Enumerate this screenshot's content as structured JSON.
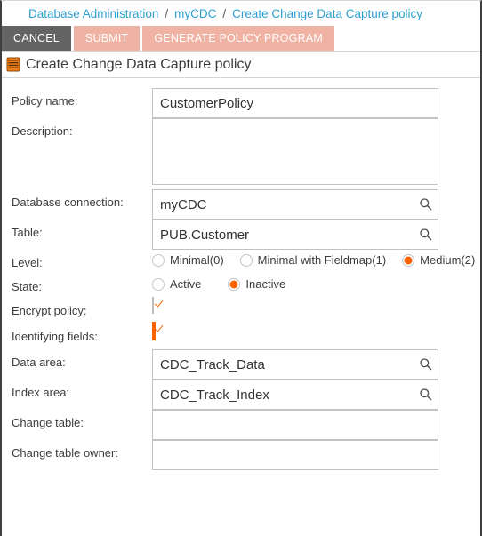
{
  "breadcrumb": {
    "separator": "/",
    "items": [
      {
        "label": "Database Administration"
      },
      {
        "label": "myCDC"
      },
      {
        "label": "Create Change Data Capture policy"
      }
    ]
  },
  "toolbar": {
    "cancel_label": "CANCEL",
    "submit_label": "SUBMIT",
    "generate_label": "GENERATE POLICY PROGRAM",
    "cancel_color": "#636363",
    "action_color": "#f0b3a3"
  },
  "page_title": {
    "text": "Create Change Data Capture policy",
    "icon": "database-icon"
  },
  "colors": {
    "accent": "#fa6400",
    "link": "#2f9fd0",
    "border": "#c2c2c2"
  },
  "form": {
    "policy_name": {
      "label": "Policy name:",
      "value": "CustomerPolicy",
      "placeholder": ""
    },
    "description": {
      "label": "Description:",
      "value": "",
      "placeholder": ""
    },
    "database_connection": {
      "label": "Database connection:",
      "value": "myCDC",
      "placeholder": "",
      "icon": "search-icon"
    },
    "table": {
      "label": "Table:",
      "value": "PUB.Customer",
      "placeholder": "",
      "icon": "search-icon"
    },
    "level": {
      "label": "Level:",
      "options": [
        {
          "label": "Minimal(0)",
          "selected": false
        },
        {
          "label": "Minimal with Fieldmap(1)",
          "selected": false
        },
        {
          "label": "Medium(2)",
          "selected": true
        }
      ]
    },
    "state": {
      "label": "State:",
      "options": [
        {
          "label": "Active",
          "selected": false
        },
        {
          "label": "Inactive",
          "selected": true
        }
      ]
    },
    "encrypt_policy": {
      "label": "Encrypt policy:",
      "checked": true,
      "focused": false
    },
    "identifying_fields": {
      "label": "Identifying fields:",
      "checked": true,
      "focused": true
    },
    "data_area": {
      "label": "Data area:",
      "value": "CDC_Track_Data",
      "placeholder": "",
      "icon": "search-icon"
    },
    "index_area": {
      "label": "Index area:",
      "value": "CDC_Track_Index",
      "placeholder": "",
      "icon": "search-icon"
    },
    "change_table": {
      "label": "Change table:",
      "value": "",
      "placeholder": ""
    },
    "change_table_owner": {
      "label": "Change table owner:",
      "value": "",
      "placeholder": ""
    }
  }
}
